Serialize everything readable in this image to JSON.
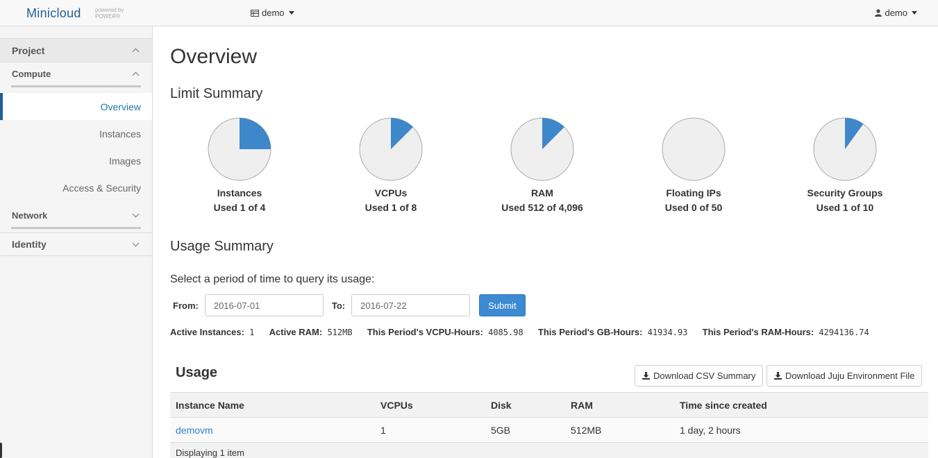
{
  "topbar": {
    "brand": "Minicloud",
    "brand_sub_1": "powered by",
    "brand_sub_2": "POWER®",
    "project_label": "demo",
    "user_label": "demo",
    "project_icon": "grid-icon",
    "user_icon": "user-icon"
  },
  "sidebar": {
    "project": "Project",
    "compute": "Compute",
    "items": [
      {
        "label": "Overview",
        "active": true
      },
      {
        "label": "Instances"
      },
      {
        "label": "Images"
      },
      {
        "label": "Access & Security"
      }
    ],
    "network": "Network",
    "identity": "Identity"
  },
  "main": {
    "title": "Overview",
    "limit_title": "Limit Summary",
    "usage_summary_title": "Usage Summary",
    "query_text": "Select a period of time to query its usage:",
    "from_label": "From:",
    "from_value": "2016-07-01",
    "to_label": "To:",
    "to_value": "2016-07-22",
    "submit": "Submit",
    "stats": {
      "active_instances_label": "Active Instances:",
      "active_instances": "1",
      "active_ram_label": "Active RAM:",
      "active_ram": "512MB",
      "vcpu_hours_label": "This Period's VCPU-Hours:",
      "vcpu_hours": "4085.98",
      "gb_hours_label": "This Period's GB-Hours:",
      "gb_hours": "41934.93",
      "ram_hours_label": "This Period's RAM-Hours:",
      "ram_hours": "4294136.74"
    },
    "usage_title": "Usage",
    "download_csv": "Download CSV Summary",
    "download_juju": "Download Juju Environment File",
    "table": {
      "headers": [
        "Instance Name",
        "VCPUs",
        "Disk",
        "RAM",
        "Time since created"
      ],
      "rows": [
        [
          "demovm",
          "1",
          "5GB",
          "512MB",
          "1 day, 2 hours"
        ]
      ],
      "footer": "Displaying 1 item"
    }
  },
  "colors": {
    "accent": "#3c8ad1",
    "pie_bg": "#efefef",
    "pie_fill": "#3f87cb"
  },
  "chart_data": [
    {
      "type": "pie",
      "title": "Instances",
      "subtitle": "Used 1 of 4",
      "used": 1,
      "total": 4
    },
    {
      "type": "pie",
      "title": "VCPUs",
      "subtitle": "Used 1 of 8",
      "used": 1,
      "total": 8
    },
    {
      "type": "pie",
      "title": "RAM",
      "subtitle": "Used 512 of 4,096",
      "used": 512,
      "total": 4096
    },
    {
      "type": "pie",
      "title": "Floating IPs",
      "subtitle": "Used 0 of 50",
      "used": 0,
      "total": 50
    },
    {
      "type": "pie",
      "title": "Security Groups",
      "subtitle": "Used 1 of 10",
      "used": 1,
      "total": 10
    }
  ]
}
